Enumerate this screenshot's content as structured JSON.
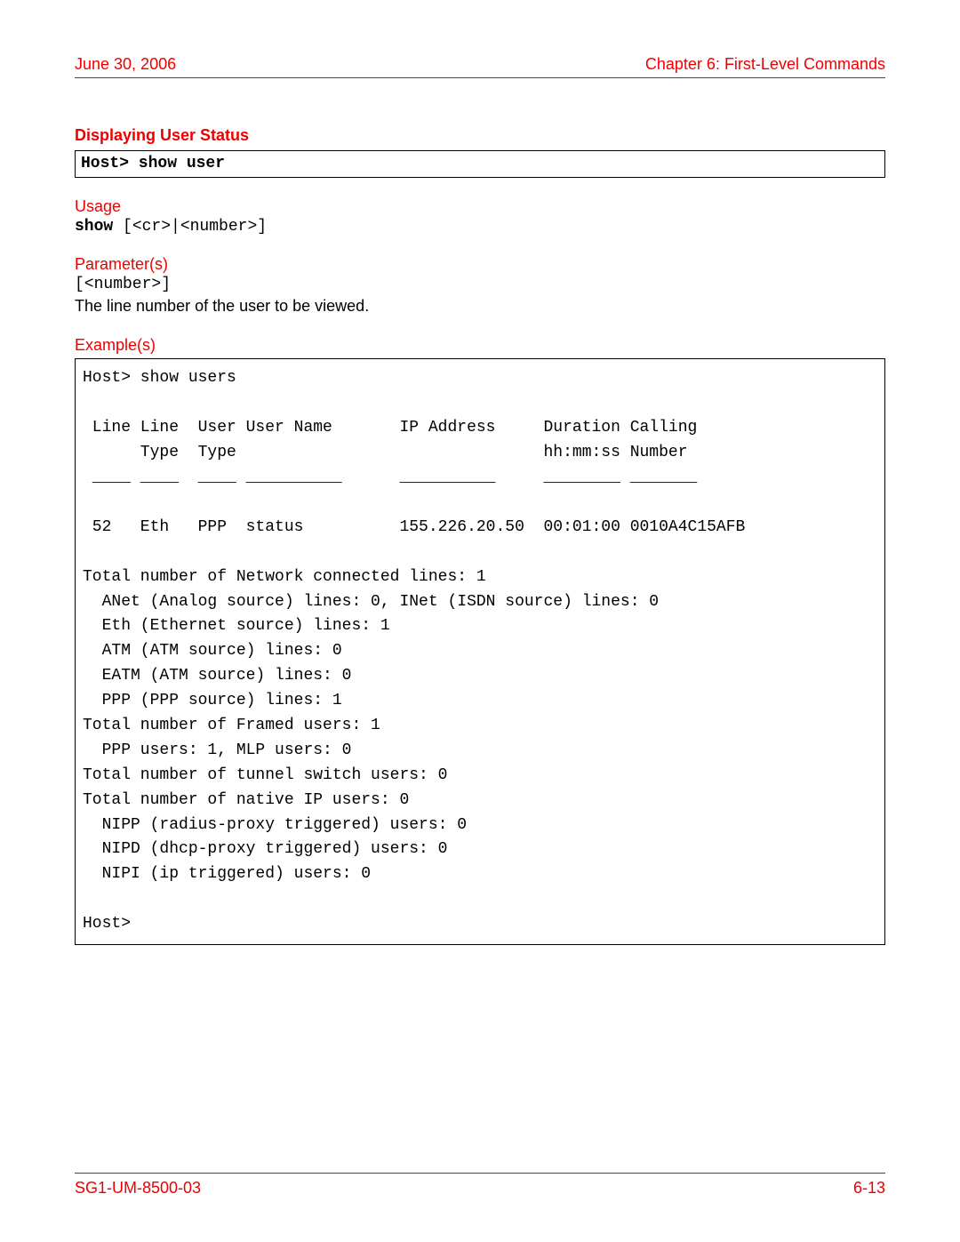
{
  "header": {
    "date": "June 30, 2006",
    "chapter": "Chapter 6: First-Level Commands"
  },
  "section_title": "Displaying User Status",
  "command_box": "Host> show user",
  "usage": {
    "heading": "Usage",
    "cmd_bold": "show",
    "cmd_rest": " [<cr>|<number>]"
  },
  "parameters": {
    "heading": "Parameter(s)",
    "param_token": "[<number>]",
    "description": "The line number of the user to be viewed."
  },
  "examples": {
    "heading": "Example(s)",
    "output": "Host> show users\n\n Line Line  User User Name       IP Address     Duration Calling\n      Type  Type                                hh:mm:ss Number\n ____ ____  ____ __________      __________     ________ _______\n\n 52   Eth   PPP  status          155.226.20.50  00:01:00 0010A4C15AFB\n\nTotal number of Network connected lines: 1\n  ANet (Analog source) lines: 0, INet (ISDN source) lines: 0\n  Eth (Ethernet source) lines: 1\n  ATM (ATM source) lines: 0\n  EATM (ATM source) lines: 0\n  PPP (PPP source) lines: 1\nTotal number of Framed users: 1\n  PPP users: 1, MLP users: 0\nTotal number of tunnel switch users: 0\nTotal number of native IP users: 0\n  NIPP (radius-proxy triggered) users: 0\n  NIPD (dhcp-proxy triggered) users: 0\n  NIPI (ip triggered) users: 0\n\nHost>"
  },
  "footer": {
    "doc_id": "SG1-UM-8500-03",
    "page_number": "6-13"
  }
}
